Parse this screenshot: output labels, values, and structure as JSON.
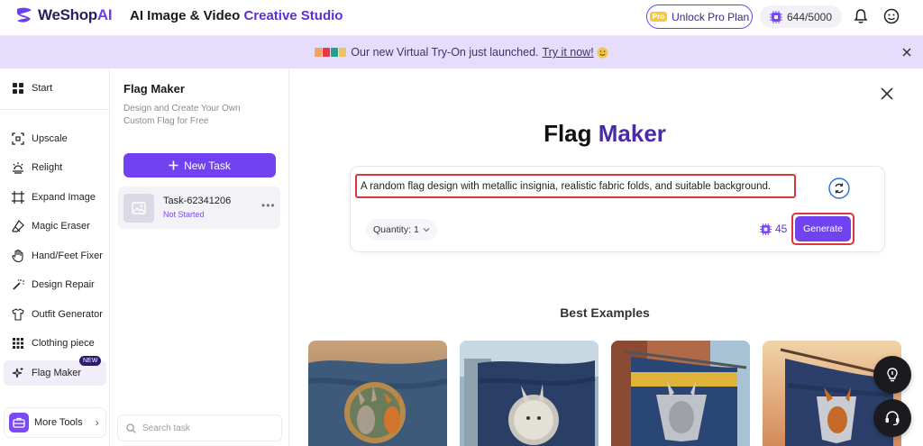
{
  "brand": {
    "name_main": "WeShop",
    "name_accent": "AI"
  },
  "header": {
    "title_main": "AI Image & Video",
    "title_accent": "Creative Studio",
    "unlock_label": "Unlock Pro Plan",
    "pro_badge": "Pro",
    "credits": "644/5000"
  },
  "banner": {
    "text": "Our new Virtual Try-On just launched.",
    "link": "Try it now!"
  },
  "sidebar": {
    "items": [
      {
        "label": "Start",
        "icon": "grid-icon"
      },
      {
        "label": "Upscale",
        "icon": "upscale-icon"
      },
      {
        "label": "Relight",
        "icon": "relight-icon"
      },
      {
        "label": "Expand Image",
        "icon": "expand-icon"
      },
      {
        "label": "Magic Eraser",
        "icon": "eraser-icon"
      },
      {
        "label": "Hand/Feet Fixer",
        "icon": "hand-icon"
      },
      {
        "label": "Design Repair",
        "icon": "wand-icon"
      },
      {
        "label": "Outfit Generator",
        "icon": "outfit-icon"
      },
      {
        "label": "Clothing piece",
        "icon": "clothing-icon"
      },
      {
        "label": "Flag Maker",
        "icon": "sparkle-icon"
      }
    ],
    "new_badge": "NEW",
    "more_tools": "More Tools"
  },
  "task_panel": {
    "title": "Flag Maker",
    "description": "Design and Create Your Own Custom Flag for Free",
    "new_task_label": "New Task",
    "task": {
      "name": "Task-62341206",
      "status": "Not Started"
    },
    "search_placeholder": "Search task"
  },
  "main": {
    "title_main": "Flag",
    "title_accent": "Maker",
    "prompt": "A random flag design with metallic insignia, realistic fabric folds, and suitable background.",
    "quantity_label": "Quantity: 1",
    "cost": "45",
    "generate_label": "Generate",
    "examples_title": "Best Examples"
  },
  "colors": {
    "accent": "#7042f0",
    "banner_bg": "#e6dcfb",
    "highlight_red": "#d9363e"
  }
}
